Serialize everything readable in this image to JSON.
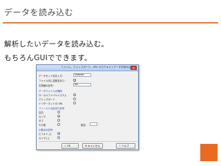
{
  "slide": {
    "title": "データを読み込む",
    "line1": "解析したいデータを読み込む。",
    "line2": "もちろんGUIでできます。"
  },
  "dialog": {
    "title": "ファイル、クリップボード、URL からテキストデータを読み込む",
    "close_glyph": "✕",
    "dataset_name_label": "データセット名を入力：",
    "dataset_name_value": "Dataset",
    "rownames_label": "ファイル内に変数名あり：",
    "missing_label": "欠測値の記号：",
    "missing_value": "NA",
    "location_heading": "データファイルの場所",
    "loc_local": "ローカルファイルシステム",
    "loc_clipboard": "クリップボード",
    "loc_url": "インターネットの URL",
    "separator_heading": "フィールドの区切り記号",
    "sep_space": "空白",
    "sep_comma": "カンマ",
    "sep_tab": "タブ",
    "sep_other": "その他",
    "sep_other_label": "指定：",
    "decimal_heading": "小数点の記号",
    "dec_period": "ピリオド [.]",
    "dec_comma": "カンマ [,]",
    "ok_label": "OK",
    "cancel_label": "キャンセル",
    "help_label": "ヘルプ"
  },
  "page_number": ""
}
